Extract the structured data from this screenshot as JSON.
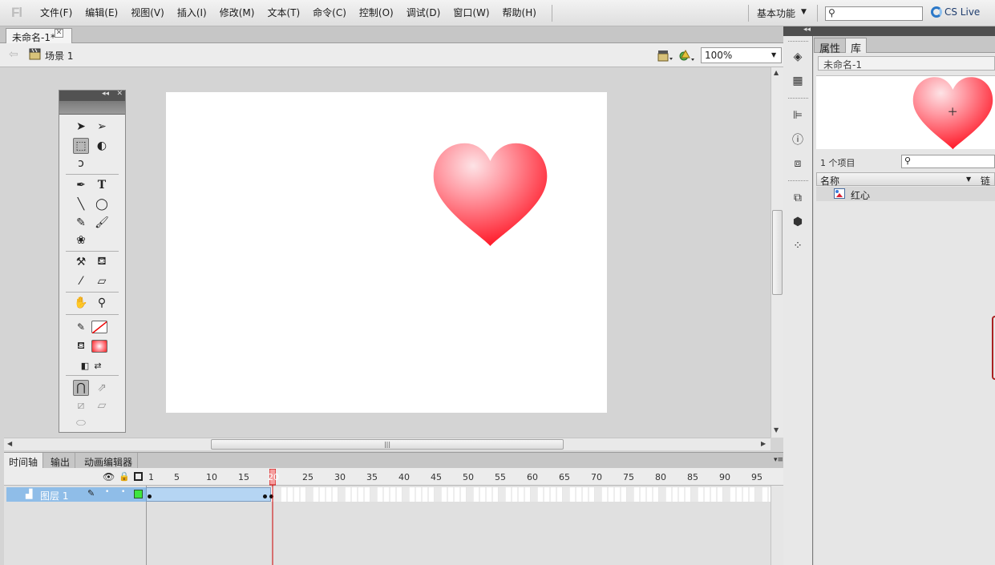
{
  "app": {
    "logo": "Fl"
  },
  "menu": {
    "items": [
      "文件(F)",
      "编辑(E)",
      "视图(V)",
      "插入(I)",
      "修改(M)",
      "文本(T)",
      "命令(C)",
      "控制(O)",
      "调试(D)",
      "窗口(W)",
      "帮助(H)"
    ],
    "workspace": "基本功能",
    "cs_live": "CS Live"
  },
  "document": {
    "tab_title": "未命名-1*",
    "scene": "场景 1",
    "zoom": "100%"
  },
  "timeline": {
    "tabs": [
      "时间轴",
      "输出",
      "动画编辑器"
    ],
    "frame_numbers": [
      "1",
      "5",
      "10",
      "15",
      "20",
      "25",
      "30",
      "35",
      "40",
      "45",
      "50",
      "55",
      "60",
      "65",
      "70",
      "75",
      "80",
      "85",
      "90",
      "95"
    ],
    "current_frame": 20,
    "layer_name": "图层 1",
    "keyframes": [
      1,
      19,
      20
    ]
  },
  "library": {
    "tabs": [
      "属性",
      "库"
    ],
    "document": "未命名-1",
    "count": "1 个项目",
    "col_name": "名称",
    "col_link": "链接",
    "items": [
      {
        "name": "红心"
      }
    ]
  },
  "colors": {
    "heart_top": "#fde3e6",
    "heart_bottom": "#ff0a1a",
    "layer_highlight": "#8fbde8",
    "tween_span": "#b5d5f3",
    "playhead": "#cc0000"
  }
}
